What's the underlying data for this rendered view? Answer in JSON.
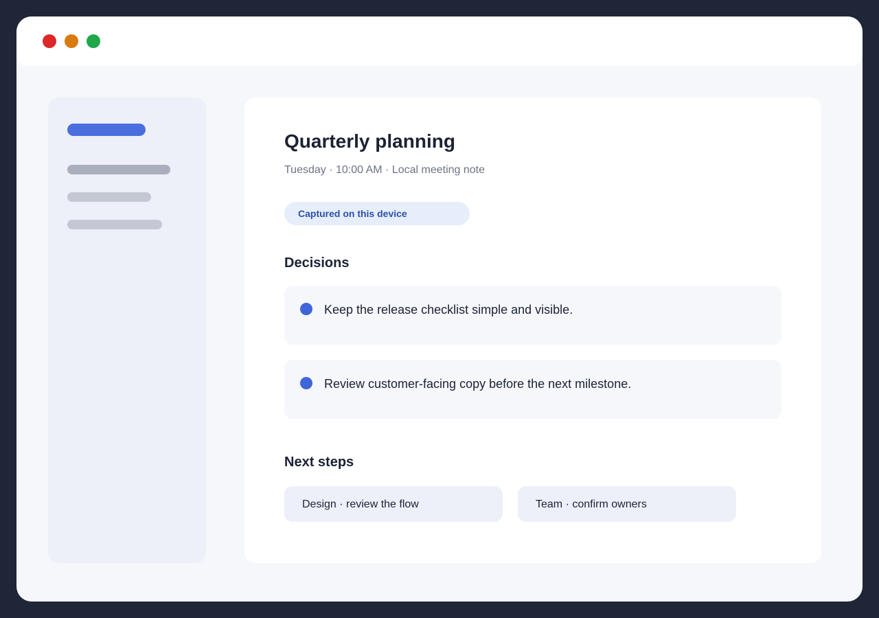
{
  "colors": {
    "window_close": "#dc2828",
    "window_minimize": "#d97a10",
    "window_maximize": "#1ea84a",
    "accent": "#4a6ede",
    "skeleton_dark": "#a9afbd",
    "skeleton_light": "#c3c8d3",
    "bullet": "#3f66d8"
  },
  "note": {
    "title": "Quarterly planning",
    "meta": "Tuesday · 10:00 AM · Local meeting note",
    "badge": "Captured on this device"
  },
  "decisions": {
    "heading": "Decisions",
    "items": [
      "Keep the release checklist simple and visible.",
      "Review customer-facing copy before the next milestone."
    ]
  },
  "next_steps": {
    "heading": "Next steps",
    "items": [
      "Design · review the flow",
      "Team · confirm owners"
    ]
  }
}
